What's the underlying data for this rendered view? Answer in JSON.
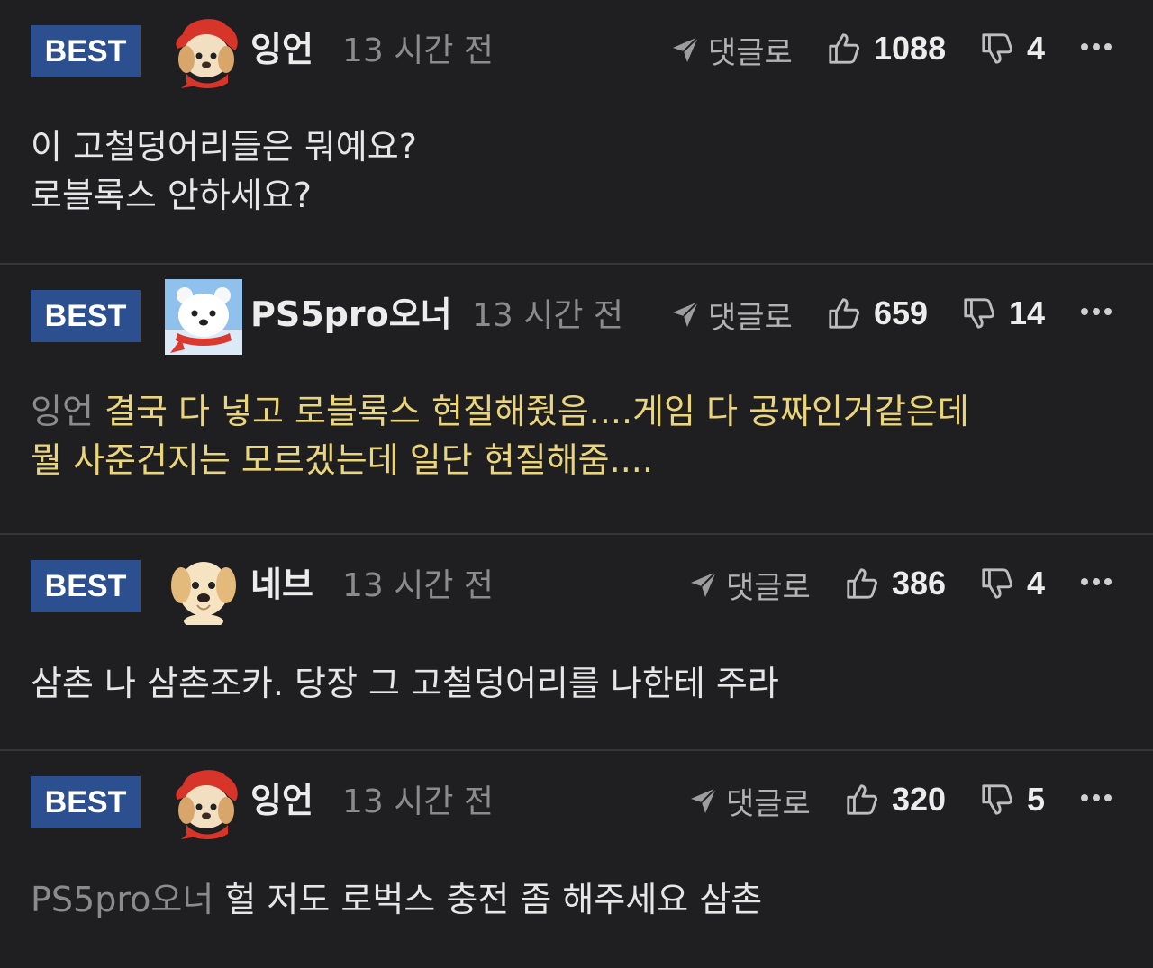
{
  "comments": [
    {
      "badge": "BEST",
      "avatar": "red-hood-puppy",
      "author": "잉언",
      "time": "13 시간 전",
      "reply_label": "댓글로",
      "likes": "1088",
      "dislikes": "4",
      "lines": [
        "이 고철덩어리들은 뭐예요?",
        "로블록스 안하세요?"
      ]
    },
    {
      "badge": "BEST",
      "avatar": "polar-bear-cub",
      "author": "PS5pro오너",
      "time": "13 시간 전",
      "reply_label": "댓글로",
      "likes": "659",
      "dislikes": "14",
      "mention": "잉언",
      "line1": "결국 다 넣고 로블록스 현질해줬음....게임 다 공짜인거같은데",
      "line2": "뭘 사준건지는 모르겠는데 일단 현질해줌...."
    },
    {
      "badge": "BEST",
      "avatar": "puppy",
      "author": "네브",
      "time": "13 시간 전",
      "reply_label": "댓글로",
      "likes": "386",
      "dislikes": "4",
      "text": "삼촌 나 삼촌조카. 당장 그 고철덩어리를 나한테 주라"
    },
    {
      "badge": "BEST",
      "avatar": "red-hood-puppy",
      "author": "잉언",
      "time": "13 시간 전",
      "reply_label": "댓글로",
      "likes": "320",
      "dislikes": "5",
      "mention": "PS5pro오너",
      "text": "헐 저도 로벅스 충전 좀 해주세요 삼촌"
    }
  ],
  "colors": {
    "background": "#1f1f21",
    "badge": "#2c4f8f",
    "highlight": "#ebd57a",
    "muted": "#8b8b8d"
  }
}
